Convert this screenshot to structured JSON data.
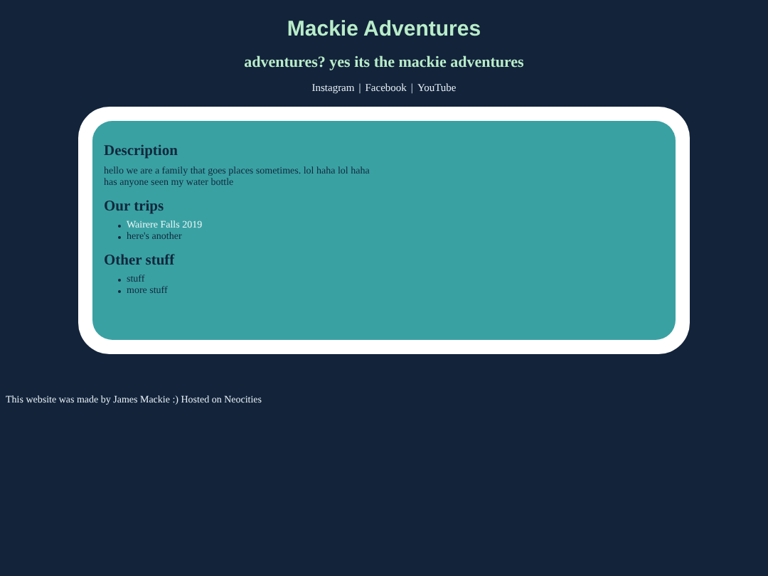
{
  "header": {
    "title": "Mackie Adventures",
    "subtitle": "adventures? yes its the mackie adventures",
    "links": [
      "Instagram",
      "Facebook",
      "YouTube"
    ],
    "separator": "|"
  },
  "card": {
    "sections": [
      {
        "heading": "Description",
        "kind": "text",
        "lines": [
          "hello we are a family that goes places sometimes. lol haha lol haha",
          "has anyone seen my water bottle"
        ]
      },
      {
        "heading": "Our trips",
        "kind": "list",
        "items": [
          {
            "text": "Wairere Falls 2019",
            "kind": "link"
          },
          {
            "text": "here's another",
            "kind": "text"
          }
        ]
      },
      {
        "heading": "Other stuff",
        "kind": "list",
        "items": [
          {
            "text": "stuff",
            "kind": "text"
          },
          {
            "text": "more stuff",
            "kind": "text"
          }
        ]
      }
    ]
  },
  "footer": "This website was made by James Mackie :) Hosted on Neocities"
}
